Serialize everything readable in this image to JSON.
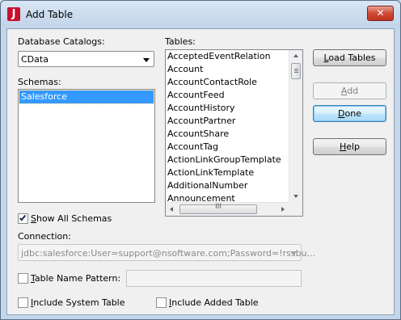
{
  "window": {
    "title": "Add Table",
    "app_icon_letter": "J",
    "close_glyph": "✕"
  },
  "catalogs": {
    "label": "Database Catalogs:",
    "selected": "CData"
  },
  "schemas": {
    "label": "Schemas:",
    "items": [
      "Salesforce"
    ],
    "selected_index": 0
  },
  "tables": {
    "label": "Tables:",
    "items": [
      "AcceptedEventRelation",
      "Account",
      "AccountContactRole",
      "AccountFeed",
      "AccountHistory",
      "AccountPartner",
      "AccountShare",
      "AccountTag",
      "ActionLinkGroupTemplate",
      "ActionLinkTemplate",
      "AdditionalNumber",
      "Announcement"
    ],
    "hscroll_grip": "III"
  },
  "buttons": {
    "load_tables": {
      "pre": "",
      "mnemonic": "L",
      "post": "oad Tables"
    },
    "add": {
      "pre": "",
      "mnemonic": "A",
      "post": "dd"
    },
    "done": {
      "pre": "",
      "mnemonic": "D",
      "post": "one"
    },
    "help": {
      "pre": "",
      "mnemonic": "H",
      "post": "elp"
    }
  },
  "show_all_schemas": {
    "pre": "",
    "mnemonic": "S",
    "post": "how All Schemas",
    "checked": true
  },
  "connection": {
    "label": "Connection:",
    "value": "jdbc:salesforce:User=support@nsoftware.com;Password=!rssbu...",
    "enabled": false
  },
  "table_name_pattern": {
    "pre": "",
    "mnemonic": "T",
    "post": "able Name Pattern:",
    "checked": false,
    "value": ""
  },
  "include_system_table": {
    "pre": "",
    "mnemonic": "I",
    "post": "nclude System Table",
    "checked": false
  },
  "include_added_table": {
    "pre": "",
    "mnemonic": "I",
    "post": "nclude Added Table",
    "checked": false
  }
}
